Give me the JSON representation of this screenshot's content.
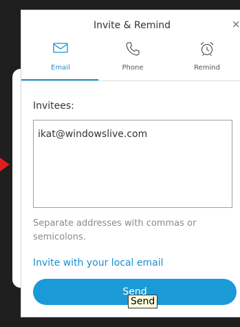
{
  "dialog": {
    "title": "Invite & Remind",
    "close_glyph": "×"
  },
  "tabs": [
    {
      "label": "Email",
      "icon": "envelope-icon",
      "active": true
    },
    {
      "label": "Phone",
      "icon": "phone-icon",
      "active": false
    },
    {
      "label": "Remind",
      "icon": "alarm-clock-icon",
      "active": false
    }
  ],
  "invitees": {
    "label": "Invitees:",
    "value": "ikat@windowslive.com",
    "hint": "Separate addresses with commas or semicolons."
  },
  "local_email_link": "Invite with your local email",
  "send_button": {
    "label": "Send"
  },
  "tooltip": "Send",
  "colors": {
    "accent": "#1a8dd1",
    "send_button": "#1a9bd7",
    "arrow": "#e01e1e"
  }
}
